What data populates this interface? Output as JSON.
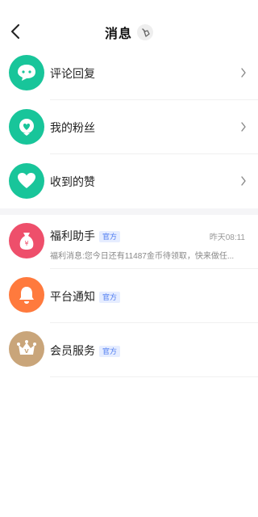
{
  "header": {
    "title": "消息",
    "back_icon": "chevron-left-icon",
    "clear_icon": "broom-icon"
  },
  "interactions": [
    {
      "label": "评论回复",
      "icon": "comment-bubble-icon",
      "color": "#18c59a"
    },
    {
      "label": "我的粉丝",
      "icon": "fan-heart-icon",
      "color": "#18c59a"
    },
    {
      "label": "收到的赞",
      "icon": "heart-icon",
      "color": "#18c59a"
    }
  ],
  "official": [
    {
      "label": "福利助手",
      "tag": "官方",
      "time": "昨天08:11",
      "preview": "福利消息:您今日还有11487金币待领取，快来做任...",
      "icon": "money-bag-icon",
      "color": "#ee4f6b"
    },
    {
      "label": "平台通知",
      "tag": "官方",
      "icon": "bell-icon",
      "color": "#ff7a3d"
    },
    {
      "label": "会员服务",
      "tag": "官方",
      "icon": "crown-icon",
      "color": "#c9a57a"
    }
  ]
}
